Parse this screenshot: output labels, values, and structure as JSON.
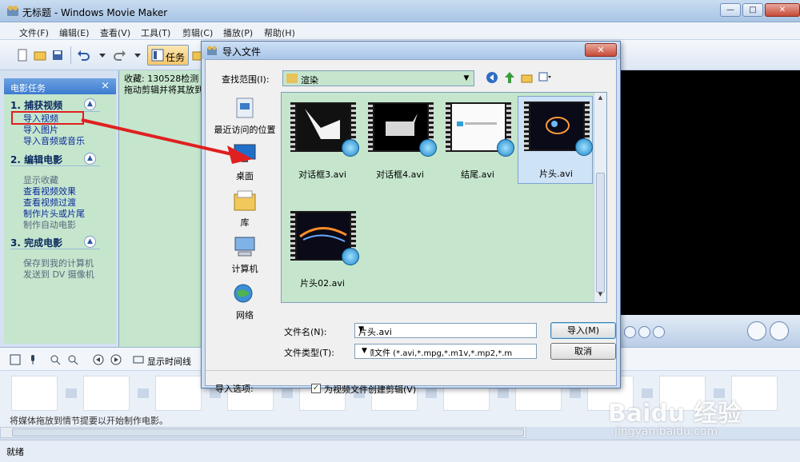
{
  "window": {
    "title": "无标题 - Windows Movie Maker",
    "buttons": {
      "minimize": "—",
      "maximize": "□",
      "close": "✕"
    }
  },
  "menu": [
    {
      "label": "文件(F)"
    },
    {
      "label": "编辑(E)"
    },
    {
      "label": "查看(V)"
    },
    {
      "label": "工具(T)"
    },
    {
      "label": "剪辑(C)"
    },
    {
      "label": "播放(P)"
    },
    {
      "label": "帮助(H)"
    }
  ],
  "toolbar": {
    "tasks_label": "任务"
  },
  "task_pane": {
    "title": "电影任务",
    "close": "×",
    "sections": [
      {
        "title": "1. 捕获视频",
        "chevron": "▲",
        "links": [
          {
            "label": "导入视频",
            "dim": false
          },
          {
            "label": "导入图片",
            "dim": false
          },
          {
            "label": "导入音频或音乐",
            "dim": false
          }
        ]
      },
      {
        "title": "2. 编辑电影",
        "chevron": "▲",
        "links": [
          {
            "label": "显示收藏",
            "dim": true
          },
          {
            "label": "查看视频效果",
            "dim": false
          },
          {
            "label": "查看视频过渡",
            "dim": false
          },
          {
            "label": "制作片头或片尾",
            "dim": false
          },
          {
            "label": "制作自动电影",
            "dim": true
          }
        ]
      },
      {
        "title": "3. 完成电影",
        "chevron": "▲",
        "links": [
          {
            "label": "保存到我的计算机",
            "dim": true
          },
          {
            "label": "发送到 DV 摄像机",
            "dim": true
          }
        ]
      }
    ]
  },
  "collection": {
    "line1": "收藏: 130528检测",
    "line2": "拖动剪辑并将其放到"
  },
  "storyboard": {
    "show_timeline": "显示时间线",
    "hint": "将媒体拖放到情节提要以开始制作电影。"
  },
  "status": {
    "text": "就绪"
  },
  "watermark": {
    "brand": "Baidu 经验",
    "url": "jingyan.baidu.com"
  },
  "dialog": {
    "title": "导入文件",
    "close": "✕",
    "look_in_label": "查找范围(I):",
    "look_in_value": "渲染",
    "places": [
      {
        "label": "最近访问的位置",
        "icon": "recent-places-icon"
      },
      {
        "label": "桌面",
        "icon": "desktop-icon"
      },
      {
        "label": "库",
        "icon": "libraries-icon"
      },
      {
        "label": "计算机",
        "icon": "computer-icon"
      },
      {
        "label": "网络",
        "icon": "network-icon"
      }
    ],
    "files": [
      {
        "name": "对话框3.avi",
        "selected": false
      },
      {
        "name": "对话框4.avi",
        "selected": false
      },
      {
        "name": "结尾.avi",
        "selected": false
      },
      {
        "name": "片头.avi",
        "selected": true
      },
      {
        "name": "片头02.avi",
        "selected": false
      }
    ],
    "filename_label": "文件名(N):",
    "filename_value": "片头.avi",
    "filetype_label": "文件类型(T):",
    "filetype_value": "视频文件 (*.avi,*.mpg,*.m1v,*.mp2,*.m",
    "import_button": "导入(M)",
    "cancel_button": "取消",
    "options_label": "导入选项:",
    "create_clips_label": "为视频文件创建剪辑(V)",
    "create_clips_checked": true
  },
  "colors": {
    "panel_green": "#c5e6cd",
    "annotation_red": "#e02020",
    "link_blue": "#0a2a9b"
  }
}
